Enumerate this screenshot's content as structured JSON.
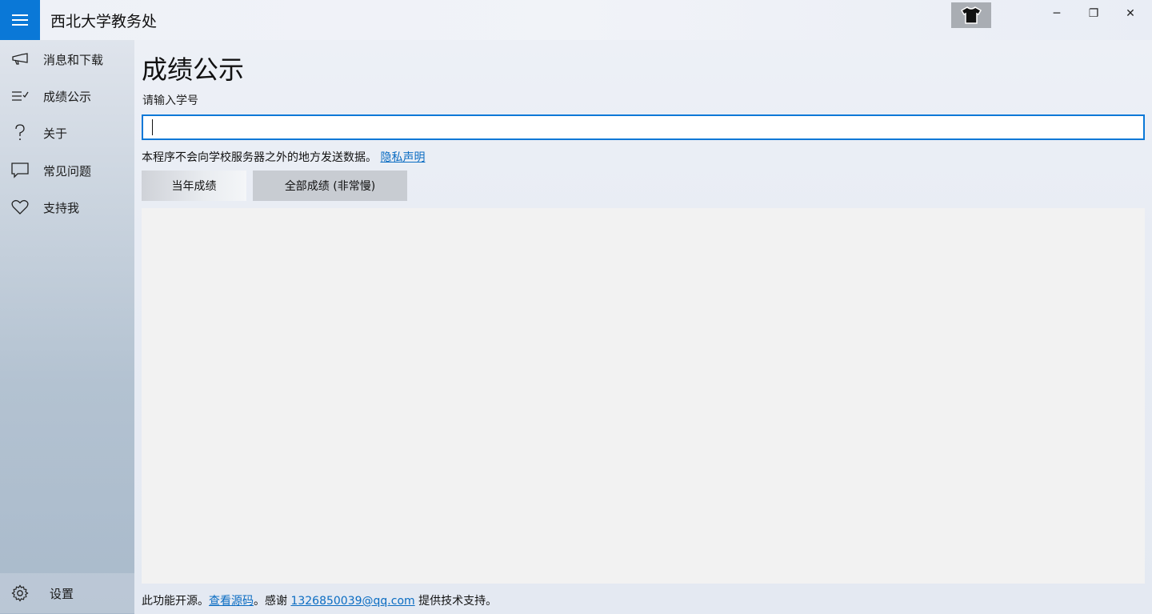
{
  "app": {
    "title": "西北大学教务处"
  },
  "titlebar": {
    "minimize": "─",
    "restore": "❐",
    "close": "✕"
  },
  "sidebar": {
    "items": [
      {
        "label": "消息和下载",
        "icon": "megaphone-icon"
      },
      {
        "label": "成绩公示",
        "icon": "list-check-icon"
      },
      {
        "label": "关于",
        "icon": "question-icon"
      },
      {
        "label": "常见问题",
        "icon": "chat-bubble-icon"
      },
      {
        "label": "支持我",
        "icon": "heart-icon"
      }
    ],
    "settings": {
      "label": "设置",
      "icon": "gear-icon"
    }
  },
  "main": {
    "title": "成绩公示",
    "input_label": "请输入学号",
    "input_value": "",
    "notice_text": "本程序不会向学校服务器之外的地方发送数据。",
    "privacy_link": "隐私声明",
    "buttons": {
      "current_year": "当年成绩",
      "all": "全部成绩 (非常慢)"
    }
  },
  "footer": {
    "prefix": "此功能开源。",
    "source_link": "查看源码",
    "thanks": "。感谢 ",
    "email_link": "1326850039@qq.com",
    "suffix": " 提供技术支持。"
  },
  "colors": {
    "accent": "#0a78d7",
    "link": "#0a6cc2"
  }
}
